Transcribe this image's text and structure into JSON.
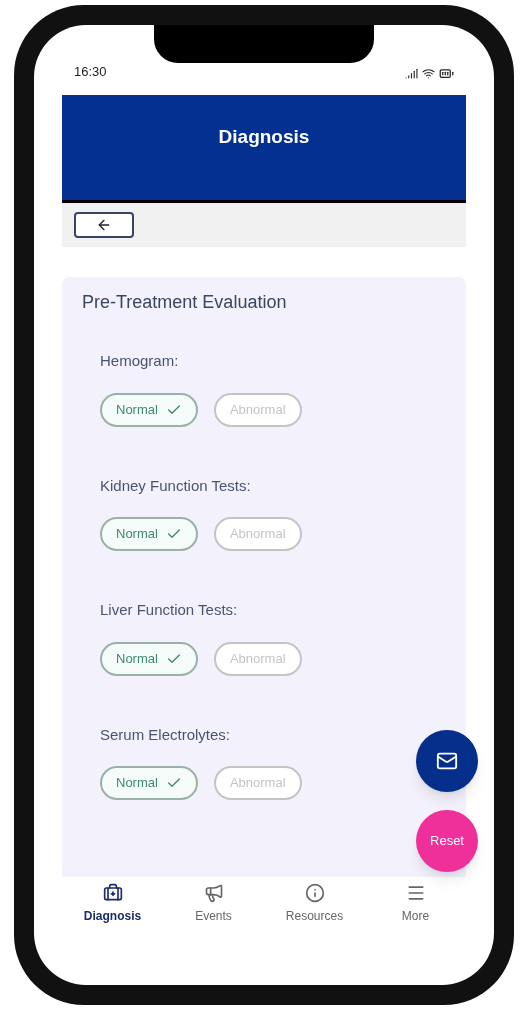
{
  "status_bar": {
    "time": "16:30"
  },
  "header": {
    "title": "Diagnosis"
  },
  "section": {
    "title": "Pre-Treatment Evaluation",
    "tests": [
      {
        "label": "Hemogram:",
        "options": [
          {
            "label": "Normal",
            "selected": true
          },
          {
            "label": "Abnormal",
            "selected": false
          }
        ]
      },
      {
        "label": "Kidney Function Tests:",
        "options": [
          {
            "label": "Normal",
            "selected": true
          },
          {
            "label": "Abnormal",
            "selected": false
          }
        ]
      },
      {
        "label": "Liver Function Tests:",
        "options": [
          {
            "label": "Normal",
            "selected": true
          },
          {
            "label": "Abnormal",
            "selected": false
          }
        ]
      },
      {
        "label": "Serum Electrolytes:",
        "options": [
          {
            "label": "Normal",
            "selected": true
          },
          {
            "label": "Abnormal",
            "selected": false
          }
        ]
      }
    ]
  },
  "fabs": {
    "reset_label": "Reset"
  },
  "bottom_nav": [
    {
      "kind": "case",
      "label": "Diagnosis",
      "selected": true
    },
    {
      "kind": "megaphone",
      "label": "Events",
      "selected": false
    },
    {
      "kind": "info",
      "label": "Resources",
      "selected": false
    },
    {
      "kind": "menu",
      "label": "More",
      "selected": false
    }
  ]
}
